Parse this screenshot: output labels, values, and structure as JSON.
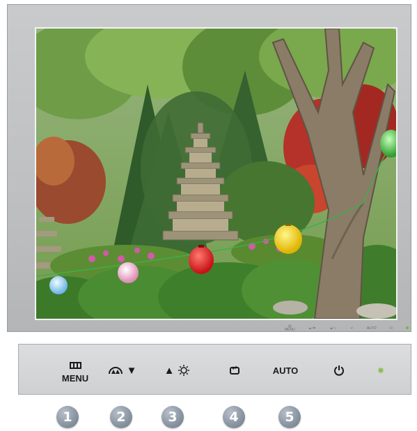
{
  "monitor": {
    "bezel_color": "#c4c5c7",
    "mini_controls": [
      {
        "icon": "menu-icon",
        "label": "MENU"
      },
      {
        "icon": "brightness-down-icon",
        "label": "▲/▼"
      },
      {
        "icon": "brightness-up-icon",
        "label": "▲/☼"
      },
      {
        "icon": "enter-icon",
        "label": ""
      },
      {
        "icon": "auto-icon",
        "label": "AUTO"
      },
      {
        "icon": "power-icon",
        "label": ""
      },
      {
        "icon": "power-led-icon",
        "label": ""
      }
    ]
  },
  "control_panel": {
    "menu_label": "MENU",
    "down_arrow": "▼",
    "up_arrow": "▲",
    "auto_label": "AUTO",
    "led_color": "#8bc34a"
  },
  "badges": [
    "1",
    "2",
    "3",
    "4",
    "5"
  ]
}
